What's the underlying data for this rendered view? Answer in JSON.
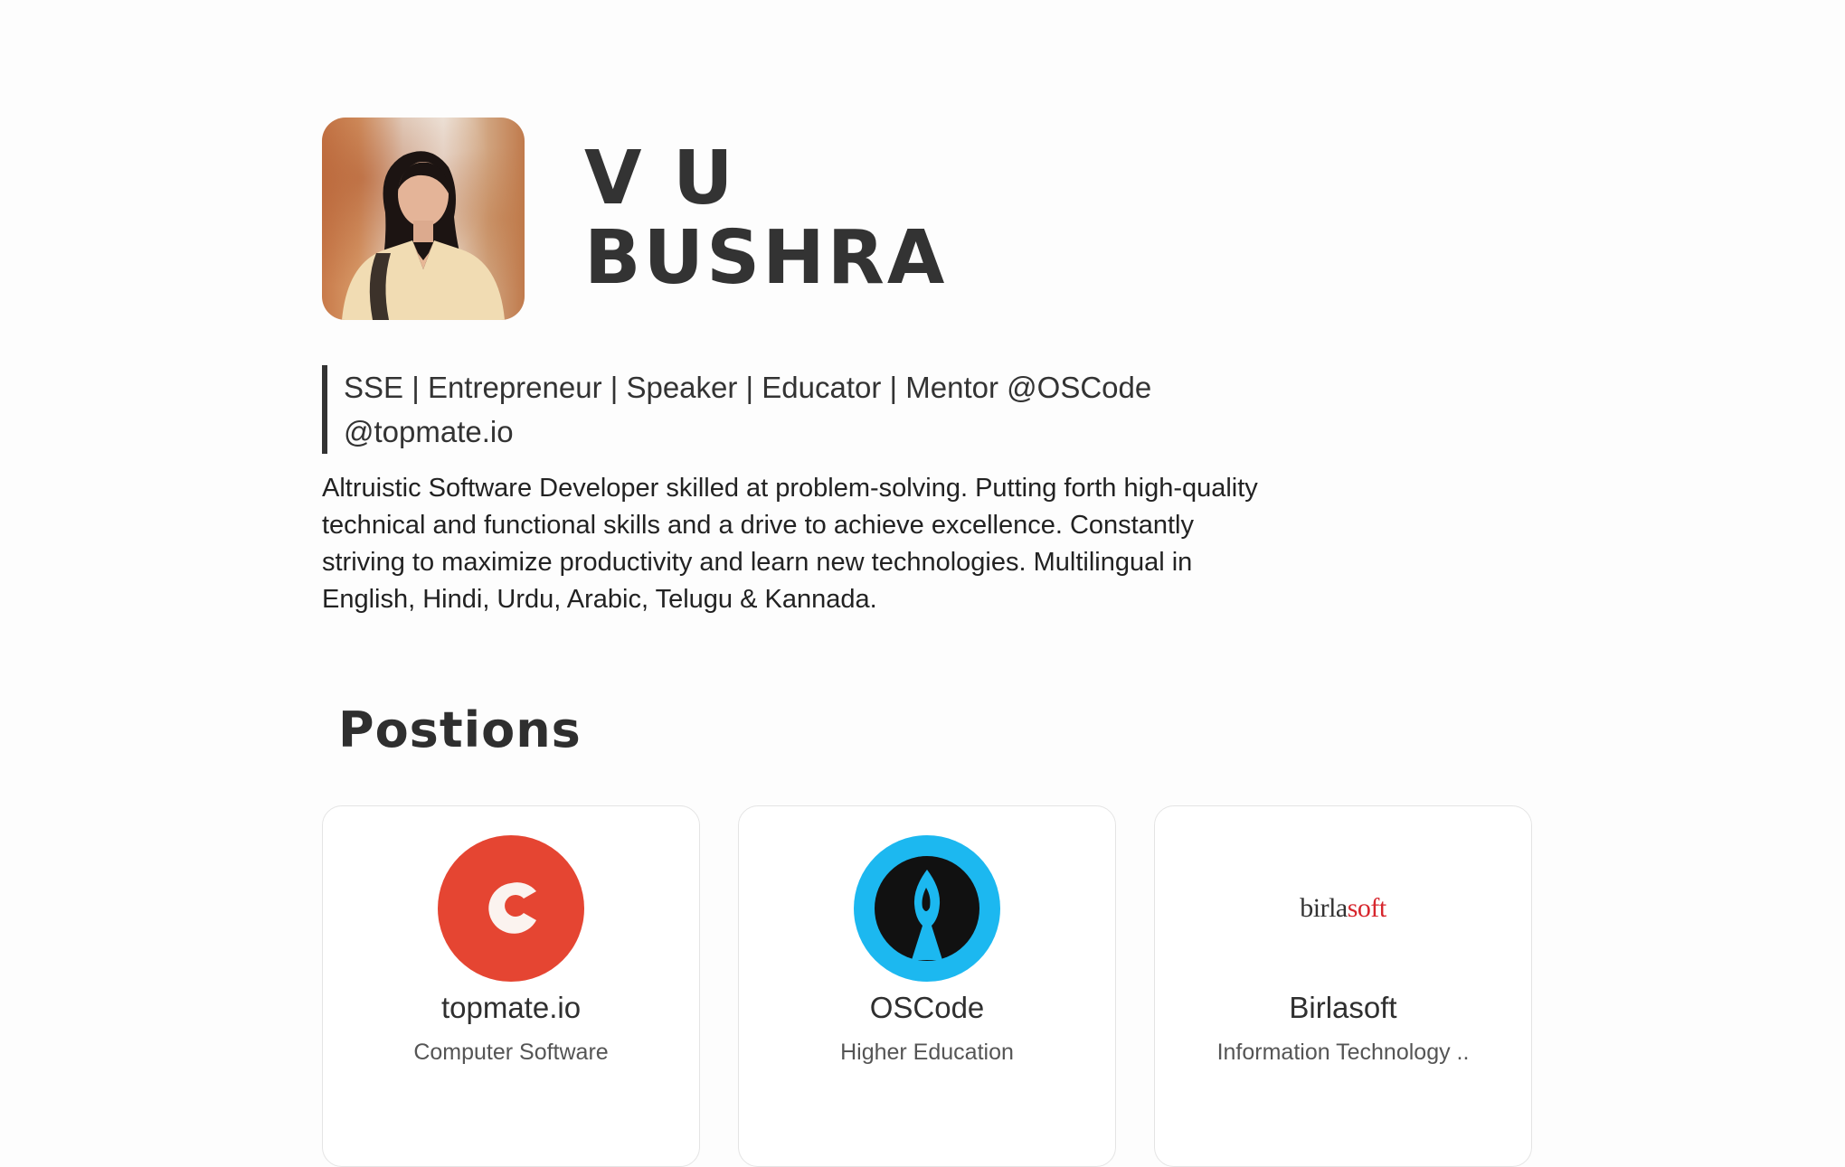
{
  "profile": {
    "first_name": "V U",
    "last_name": "BUSHRA",
    "headline_line1": "SSE | Entrepreneur | Speaker | Educator | Mentor @OSCode",
    "headline_line2": "@topmate.io",
    "bio": "Altruistic Software Developer skilled at problem-solving. Putting forth high-quality technical and functional skills and a drive to achieve excellence. Constantly striving to maximize productivity and learn new technologies. Multilingual in English, Hindi, Urdu, Arabic, Telugu & Kannada."
  },
  "positions": {
    "title": "Postions",
    "items": [
      {
        "name": "topmate.io",
        "industry": "Computer Software",
        "logo": "topmate-logo",
        "color": "#e54532"
      },
      {
        "name": "OSCode",
        "industry": "Higher Education",
        "logo": "oscode-logo",
        "color": "#1cb8f0"
      },
      {
        "name": "Birlasoft",
        "industry": "Information Technology ..",
        "logo_text_a": "birla",
        "logo_text_b": "soft",
        "color": "#d7262d"
      }
    ]
  }
}
